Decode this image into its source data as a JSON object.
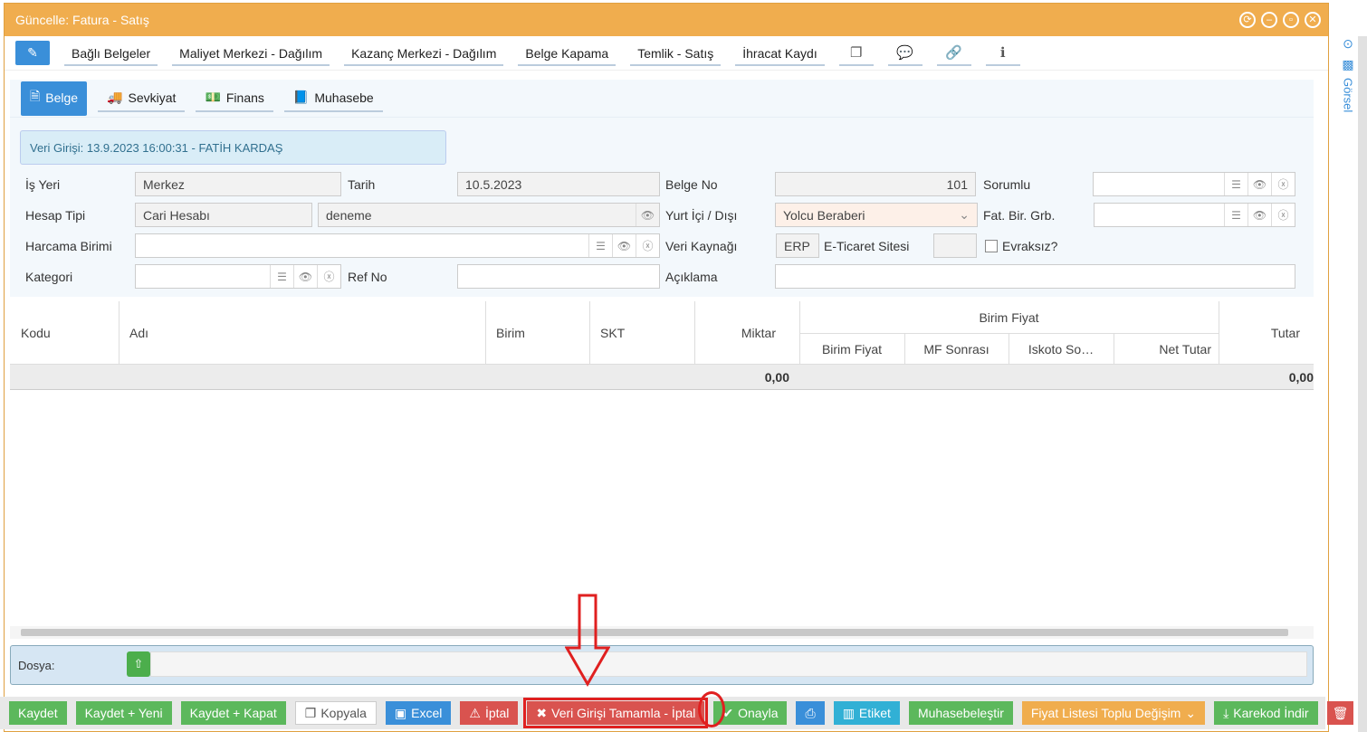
{
  "window": {
    "title": "Güncelle: Fatura - Satış"
  },
  "toolbar": {
    "links": [
      "Bağlı Belgeler",
      "Maliyet Merkezi - Dağılım",
      "Kazanç Merkezi - Dağılım",
      "Belge Kapama",
      "Temlik - Satış",
      "İhracat Kaydı"
    ]
  },
  "tabs": [
    "Belge",
    "Sevkiyat",
    "Finans",
    "Muhasebe"
  ],
  "info": "Veri Girişi: 13.9.2023 16:00:31 - FATİH KARDAŞ",
  "form": {
    "is_yeri_label": "İş Yeri",
    "is_yeri": "Merkez",
    "tarih_label": "Tarih",
    "tarih": "10.5.2023",
    "belge_no_label": "Belge No",
    "belge_no": "101",
    "sorumlu_label": "Sorumlu",
    "hesap_tipi_label": "Hesap Tipi",
    "hesap_tipi": "Cari Hesabı",
    "hesap": "deneme",
    "yurt_label": "Yurt İçi / Dışı",
    "yurt": "Yolcu Beraberi",
    "fat_label": "Fat. Bir. Grb.",
    "harcama_label": "Harcama Birimi",
    "veri_kaynagi_label": "Veri Kaynağı",
    "veri_kaynagi": "ERP",
    "eticaret_label": "E-Ticaret Sitesi",
    "evraksiz_label": "Evraksız?",
    "kategori_label": "Kategori",
    "ref_label": "Ref No",
    "aciklama_label": "Açıklama"
  },
  "grid": {
    "cols": {
      "kodu": "Kodu",
      "adi": "Adı",
      "birim": "Birim",
      "skt": "SKT",
      "miktar": "Miktar",
      "birim_fiyat_group": "Birim Fiyat",
      "birim_fiyat": "Birim Fiyat",
      "mf": "MF Sonrası",
      "iskoto": "Iskoto So…",
      "net": "Net Tutar",
      "tutar": "Tutar"
    },
    "totals": {
      "miktar": "0,00",
      "tutar": "0,00"
    }
  },
  "dosya": {
    "label": "Dosya:"
  },
  "footer": {
    "kaydet": "Kaydet",
    "kaydet_yeni": "Kaydet + Yeni",
    "kaydet_kapat": "Kaydet + Kapat",
    "kopyala": "Kopyala",
    "excel": "Excel",
    "iptal": "İptal",
    "veri_iptal": "Veri Girişi Tamamla - İptal",
    "onayla": "Onayla",
    "etiket": "Etiket",
    "muhasebe": "Muhasebeleştir",
    "fiyat": "Fiyat Listesi Toplu Değişim",
    "karekod": "Karekod İndir"
  },
  "sidebar": {
    "label": "Görsel"
  },
  "colors": {
    "title_bar": "#f0ad4e",
    "primary": "#3a8fd9",
    "success": "#5cb85c",
    "danger": "#d9534f",
    "highlight": "#e02020"
  }
}
